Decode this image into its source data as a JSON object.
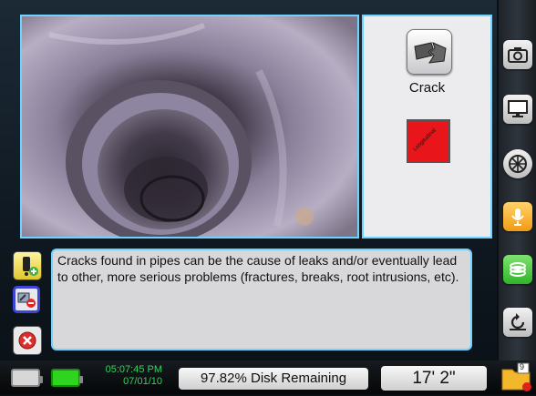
{
  "observation": {
    "name": "Crack",
    "type_label": "Longitudinal",
    "description": "Cracks found in pipes can be the cause of leaks and/or eventually lead to other, more serious problems (fractures, breaks, root intrusions, etc)."
  },
  "status": {
    "time": "05:07:45 PM",
    "date": "07/01/10",
    "disk": "97.82% Disk Remaining",
    "distance": "17' 2\"",
    "folder_badge": "9"
  },
  "icons": {
    "left": [
      "add-note-icon",
      "flag-note-icon",
      "delete-icon"
    ],
    "right": [
      "camera-icon",
      "monitor-icon",
      "brightness-icon",
      "microphone-icon",
      "sonde-icon",
      "reset-icon"
    ],
    "folder": "folder-icon"
  },
  "colors": {
    "accent_border": "#6fd3ff",
    "crack_red": "#e8161a",
    "battery_green": "#2fd41e",
    "time_green": "#35d35a"
  }
}
